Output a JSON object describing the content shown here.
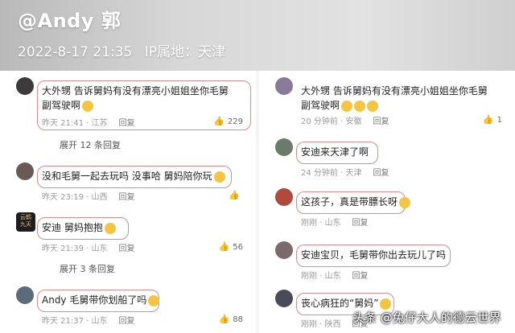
{
  "header": {
    "username": "@Andy 郭",
    "datetime": "2022-8-17 21:35",
    "location": "IP属地：天津"
  },
  "reply_label": "回复",
  "left_comments": [
    {
      "text": "大外甥  告诉舅妈有没有漂亮小姐姐坐你毛舅副驾驶啊",
      "time": "昨天 21:41",
      "loc": "江苏",
      "likes": "229"
    },
    {
      "text": "没和毛舅一起去玩吗 没事哈  舅妈陪你玩",
      "time": "昨天 23:19",
      "loc": "山西",
      "likes": ""
    },
    {
      "text": "安迪  舅妈抱抱",
      "time": "昨天 21:39",
      "loc": "山东",
      "likes": "56"
    },
    {
      "text": "Andy 毛舅带你划船了吗",
      "time": "昨天 21:37",
      "loc": "山东",
      "likes": "88"
    }
  ],
  "left_expanders": [
    "展开 12 条回复",
    "展开 3 条回复"
  ],
  "right_comments": [
    {
      "text": "大外甥  告诉舅妈有没有漂亮小姐姐坐你毛舅副驾驶啊",
      "time": "20 分钟前",
      "loc": "安徽",
      "likes": "1"
    },
    {
      "text": "安迪来天津了啊",
      "time": "24 分钟前",
      "loc": "天津",
      "likes": ""
    },
    {
      "text": "这孩子，真是带膘长呀",
      "time": "刚刚",
      "loc": "山东",
      "likes": ""
    },
    {
      "text": "安迪宝贝，毛舅带你出去玩儿了吗",
      "time": "刚刚",
      "loc": "山东",
      "likes": ""
    },
    {
      "text": "丧心病狂的“舅妈”",
      "time": "刚刚",
      "loc": "陕西",
      "likes": ""
    }
  ],
  "left_badge": "云鹤\n九天",
  "watermark": "头条 @兔仔大人的德云世界"
}
